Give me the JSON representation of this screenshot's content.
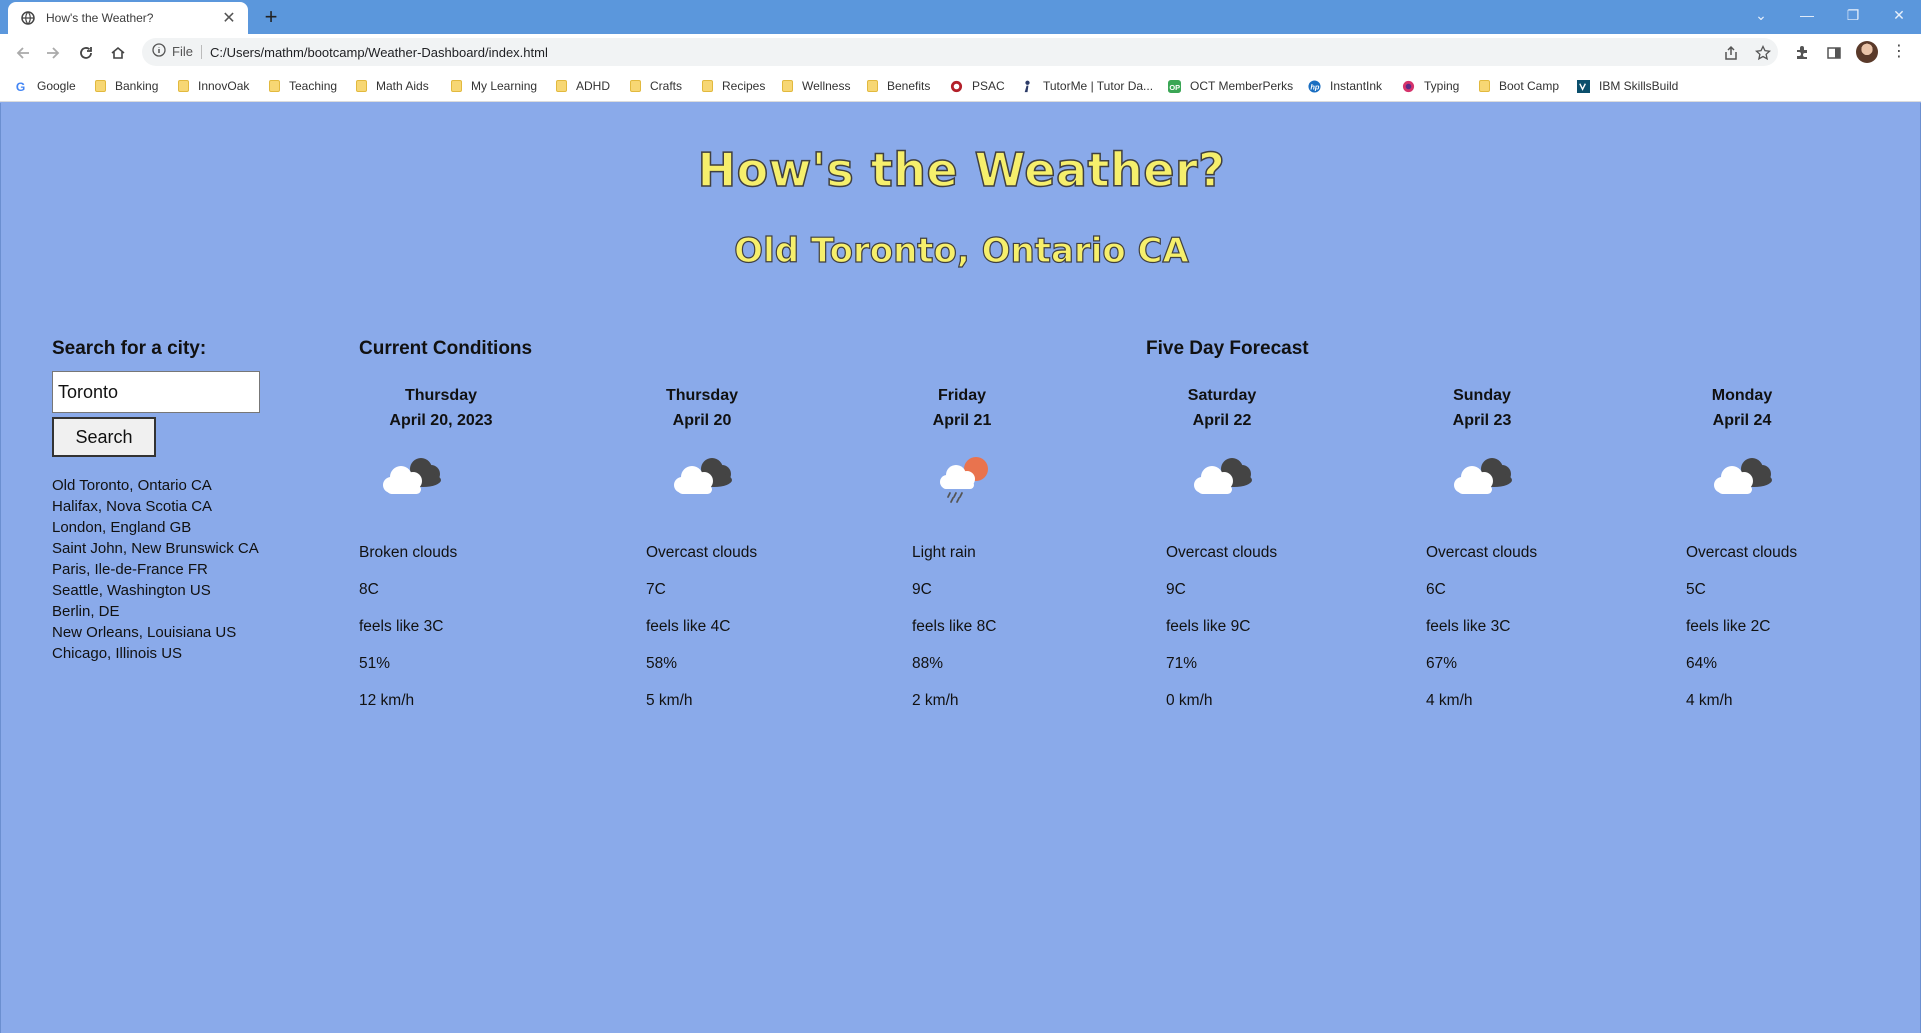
{
  "browser": {
    "tab_title": "How's the Weather?",
    "url_scheme": "File",
    "url": "C:/Users/mathm/bootcamp/Weather-Dashboard/index.html",
    "bookmarks": [
      "Google",
      "Banking",
      "InnovOak",
      "Teaching",
      "Math Aids",
      "My Learning",
      "ADHD",
      "Crafts",
      "Recipes",
      "Wellness",
      "Benefits",
      "PSAC",
      "TutorMe | Tutor Da...",
      "OCT MemberPerks",
      "InstantInk",
      "Typing",
      "Boot Camp",
      "IBM SkillsBuild"
    ]
  },
  "header": {
    "title": "How's the Weather?",
    "city": "Old Toronto, Ontario CA"
  },
  "search": {
    "label": "Search for a city:",
    "value": "Toronto",
    "button": "Search",
    "history": [
      "Old Toronto, Ontario CA",
      "Halifax, Nova Scotia CA",
      "London, England GB",
      "Saint John, New Brunswick CA",
      "Paris, Ile-de-France FR",
      "Seattle, Washington US",
      "Berlin, DE",
      "New Orleans, Louisiana US",
      "Chicago, Illinois US"
    ]
  },
  "current_title": "Current Conditions",
  "forecast_title": "Five Day Forecast",
  "cards": [
    {
      "day": "Thursday",
      "date": "April 20, 2023",
      "icon": "broken-clouds-icon",
      "desc": "Broken clouds",
      "temp": "8C",
      "feels": "feels like 3C",
      "humidity": "51%",
      "wind": "12 km/h"
    },
    {
      "day": "Thursday",
      "date": "April 20",
      "icon": "overcast-clouds-icon",
      "desc": "Overcast clouds",
      "temp": "7C",
      "feels": "feels like 4C",
      "humidity": "58%",
      "wind": "5 km/h"
    },
    {
      "day": "Friday",
      "date": "April 21",
      "icon": "light-rain-icon",
      "desc": "Light rain",
      "temp": "9C",
      "feels": "feels like 8C",
      "humidity": "88%",
      "wind": "2 km/h"
    },
    {
      "day": "Saturday",
      "date": "April 22",
      "icon": "overcast-clouds-icon",
      "desc": "Overcast clouds",
      "temp": "9C",
      "feels": "feels like 9C",
      "humidity": "71%",
      "wind": "0 km/h"
    },
    {
      "day": "Sunday",
      "date": "April 23",
      "icon": "overcast-clouds-icon",
      "desc": "Overcast clouds",
      "temp": "6C",
      "feels": "feels like 3C",
      "humidity": "67%",
      "wind": "4 km/h"
    },
    {
      "day": "Monday",
      "date": "April 24",
      "icon": "overcast-clouds-icon",
      "desc": "Overcast clouds",
      "temp": "5C",
      "feels": "feels like 2C",
      "humidity": "64%",
      "wind": "4 km/h"
    }
  ]
}
